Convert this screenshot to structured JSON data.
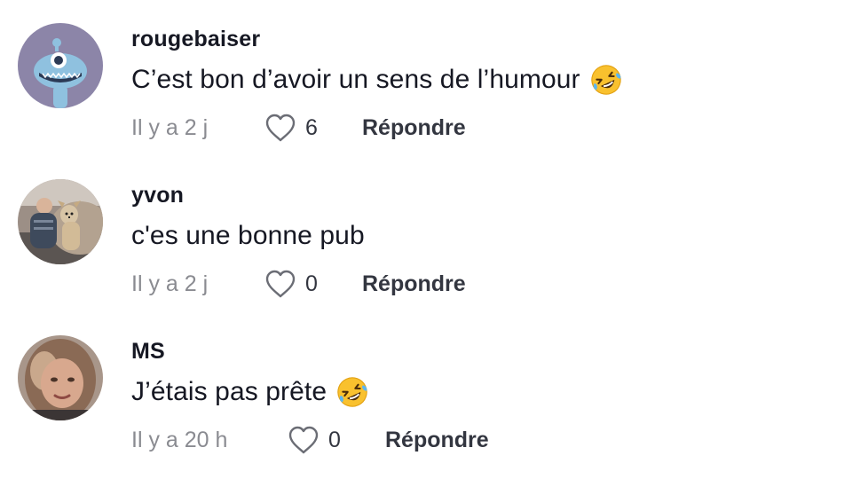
{
  "comments": [
    {
      "username": "rougebaiser",
      "text": "C’est bon d’avoir un sens de l’humour",
      "emoji": "rolling-on-floor-laughing-emoji",
      "time": "Il y a 2 j",
      "likes": "6",
      "reply_label": "Répondre",
      "avatar": "monster-cartoon-avatar"
    },
    {
      "username": "yvon",
      "text": "c'es une bonne pub",
      "time": "Il y a 2 j",
      "likes": "0",
      "reply_label": "Répondre",
      "avatar": "photo-avatar-man-with-dog"
    },
    {
      "username": "MS",
      "text": "J’étais pas prête",
      "emoji": "rolling-on-floor-laughing-emoji",
      "time": "Il y a 20 h",
      "likes": "0",
      "reply_label": "Répondre",
      "avatar": "photo-avatar-woman"
    }
  ],
  "colors": {
    "text_primary": "#161823",
    "text_secondary": "#8a8b91",
    "icon_stroke": "#6b6d75",
    "avatar_monster_bg": "#8c85a8",
    "avatar_monster_body": "#8fc1df"
  }
}
